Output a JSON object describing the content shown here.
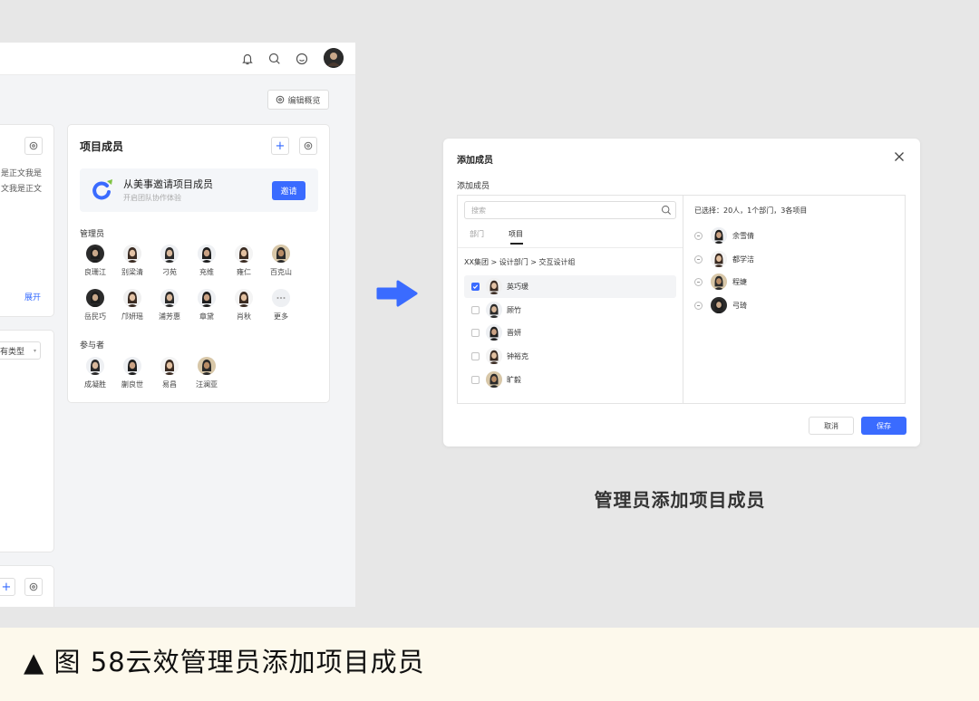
{
  "left_app": {
    "edit_overview_label": "编辑概览",
    "left_card_text_1": "是正文我是",
    "left_card_text_2": "文我是正文",
    "expand_label": "展开",
    "type_select_label": "有类型",
    "project_members": {
      "title": "项目成员",
      "invite_banner": {
        "title": "从美事邀请项目成员",
        "subtitle": "开启团队协作体验",
        "button_label": "邀请"
      },
      "admins_label": "管理员",
      "admins": [
        "良珊江",
        "别梁清",
        "刁苑",
        "充维",
        "雍仁",
        "百克山",
        "岳民巧",
        "邝妍瑶",
        "浦芳惠",
        "章黛",
        "肖秋",
        "更多"
      ],
      "participants_label": "参与者",
      "participants": [
        "成凝胜",
        "蒯良世",
        "易昌",
        "汪澜亚"
      ]
    }
  },
  "dialog": {
    "title": "添加成员",
    "subtitle": "添加成员",
    "search_placeholder": "搜索",
    "tabs": [
      "部门",
      "项目"
    ],
    "active_tab": "项目",
    "breadcrumb": "XX集团 > 设计部门 > 交互设计组",
    "members": [
      {
        "name": "英巧瑗",
        "checked": true
      },
      {
        "name": "顾竹",
        "checked": false
      },
      {
        "name": "晋妍",
        "checked": false
      },
      {
        "name": "钟裕克",
        "checked": false
      },
      {
        "name": "旷毅",
        "checked": false
      }
    ],
    "selected_summary": "已选择：20人，1个部门，3各项目",
    "selected": [
      "余雪倩",
      "都学洁",
      "程婕",
      "弓琦"
    ],
    "cancel_label": "取消",
    "save_label": "保存"
  },
  "caption_right": "管理员添加项目成员",
  "bottom_caption": "▲ 图 58云效管理员添加项目成员",
  "colors": {
    "accent": "#3a6bff",
    "arrow": "#3a6bff",
    "caption_bar": "#fdf9ec",
    "background": "#e7e7e7"
  }
}
